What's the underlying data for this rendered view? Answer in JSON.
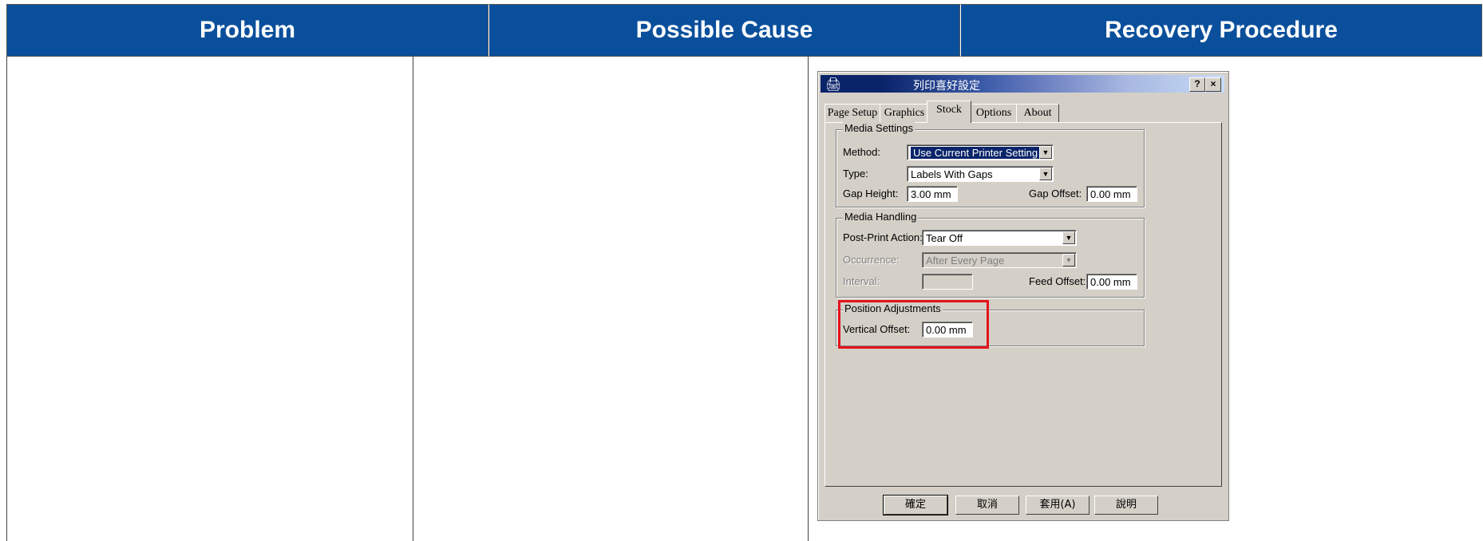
{
  "table": {
    "headers": [
      "Problem",
      "Possible Cause",
      "Recovery Procedure"
    ],
    "header_color": "#0a4f9b"
  },
  "dialog": {
    "title": "列印喜好設定",
    "help_button": "?",
    "close_button": "×",
    "tabs": [
      "Page Setup",
      "Graphics",
      "Stock",
      "Options",
      "About"
    ],
    "active_tab": "Stock",
    "media_settings": {
      "legend": "Media Settings",
      "method_label": "Method:",
      "method_value": "Use Current Printer Setting",
      "type_label": "Type:",
      "type_value": "Labels With Gaps",
      "gap_height_label": "Gap Height:",
      "gap_height_value": "3.00 mm",
      "gap_offset_label": "Gap Offset:",
      "gap_offset_value": "0.00 mm"
    },
    "media_handling": {
      "legend": "Media Handling",
      "post_print_label": "Post-Print Action:",
      "post_print_value": "Tear Off",
      "occurrence_label": "Occurrence:",
      "occurrence_value": "After Every Page",
      "interval_label": "Interval:",
      "interval_value": "",
      "feed_offset_label": "Feed Offset:",
      "feed_offset_value": "0.00 mm"
    },
    "position_adjustments": {
      "legend": "Position Adjustments",
      "vertical_offset_label": "Vertical Offset:",
      "vertical_offset_value": "0.00 mm"
    },
    "buttons": {
      "ok": "確定",
      "cancel": "取消",
      "apply": "套用(A)",
      "help": "說明"
    },
    "highlight_color": "#e3141b"
  }
}
